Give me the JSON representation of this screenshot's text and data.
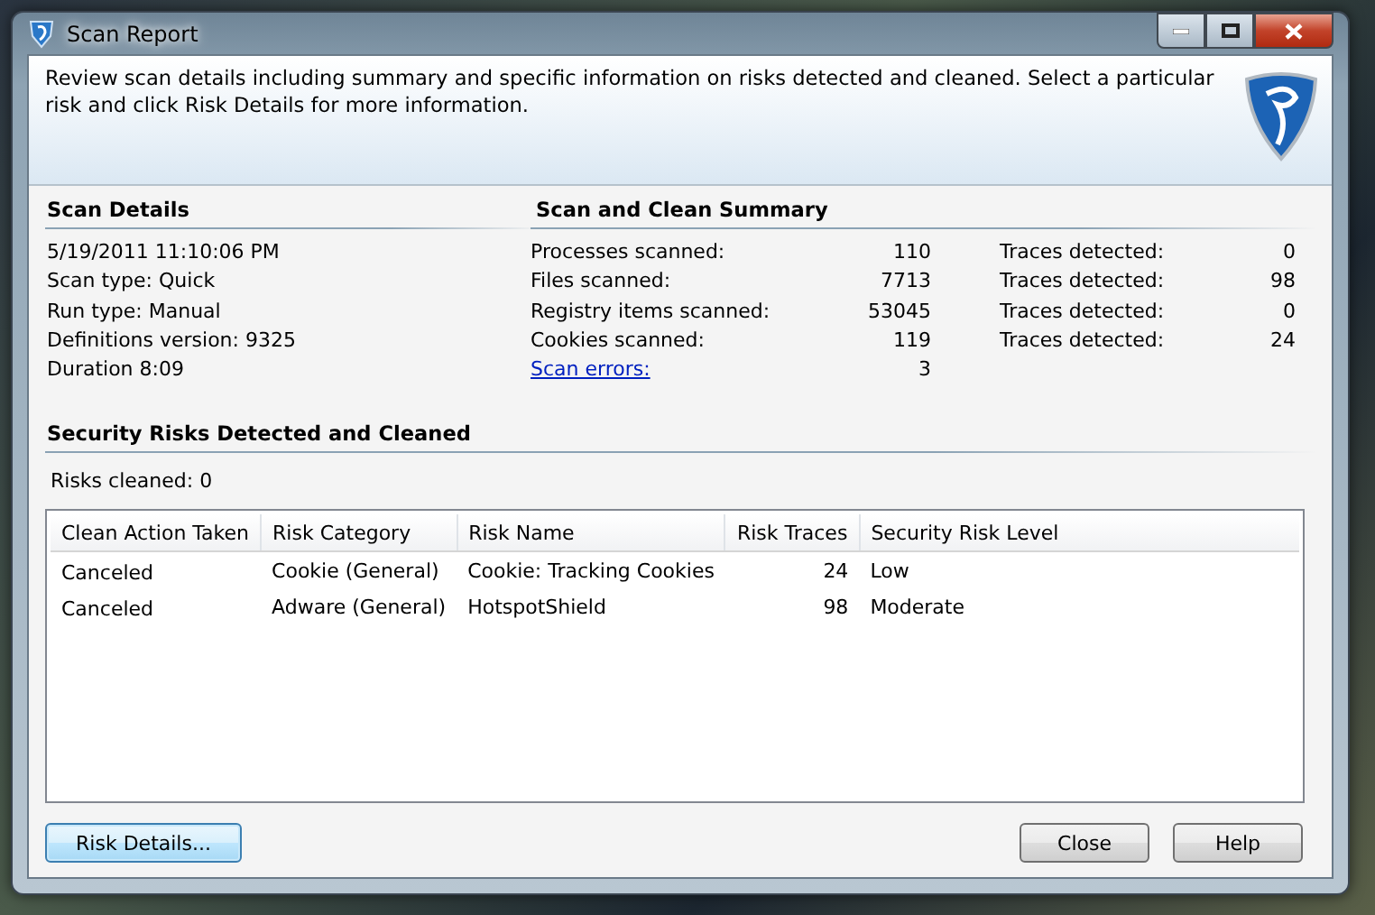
{
  "window": {
    "title": "Scan Report"
  },
  "header": {
    "description": "Review scan details including summary and specific information on risks detected and cleaned. Select a particular risk and click Risk Details for more information."
  },
  "scan_details": {
    "title": "Scan Details",
    "lines": [
      "5/19/2011 11:10:06 PM",
      "Scan type: Quick",
      "Run type: Manual",
      "Definitions version: 9325",
      "Duration 8:09"
    ]
  },
  "summary": {
    "title": "Scan and Clean Summary",
    "rows": [
      {
        "kind": "text",
        "label": "Processes scanned:",
        "value": "110",
        "traces_label": "Traces detected:",
        "traces_value": "0"
      },
      {
        "kind": "text",
        "label": "Files scanned:",
        "value": "7713",
        "traces_label": "Traces detected:",
        "traces_value": "98"
      },
      {
        "kind": "text",
        "label": "Registry items scanned:",
        "value": "53045",
        "traces_label": "Traces detected:",
        "traces_value": "0"
      },
      {
        "kind": "text",
        "label": "Cookies scanned:",
        "value": "119",
        "traces_label": "Traces detected:",
        "traces_value": "24"
      },
      {
        "kind": "link",
        "label": "Scan errors:",
        "value": "3"
      }
    ]
  },
  "risks": {
    "title": "Security Risks Detected and Cleaned",
    "cleaned": "Risks cleaned: 0"
  },
  "table": {
    "columns": [
      "Clean Action Taken",
      "Risk Category",
      "Risk Name",
      "Risk Traces",
      "Security Risk Level"
    ],
    "rows": [
      [
        "Canceled",
        "Cookie (General)",
        "Cookie: Tracking Cookies",
        "24",
        "Low"
      ],
      [
        "Canceled",
        "Adware (General)",
        "HotspotShield",
        "98",
        "Moderate"
      ]
    ]
  },
  "buttons": [
    {
      "label": "Risk Details...",
      "focused": true
    },
    {
      "label": "Close",
      "focused": false
    },
    {
      "label": "Help",
      "focused": false
    }
  ]
}
